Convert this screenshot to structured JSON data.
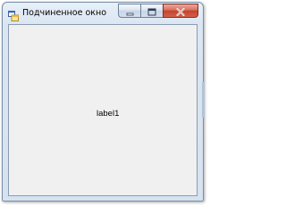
{
  "window": {
    "title": "Подчиненное окно",
    "icon": "windows-forms-app-icon",
    "caption_buttons": [
      "minimize",
      "maximize",
      "close"
    ]
  },
  "form": {
    "label_text": "label1"
  },
  "colors": {
    "client_background": "#f0f0f0",
    "close_button": "#c4432d",
    "frame": "#d6e2ef"
  }
}
